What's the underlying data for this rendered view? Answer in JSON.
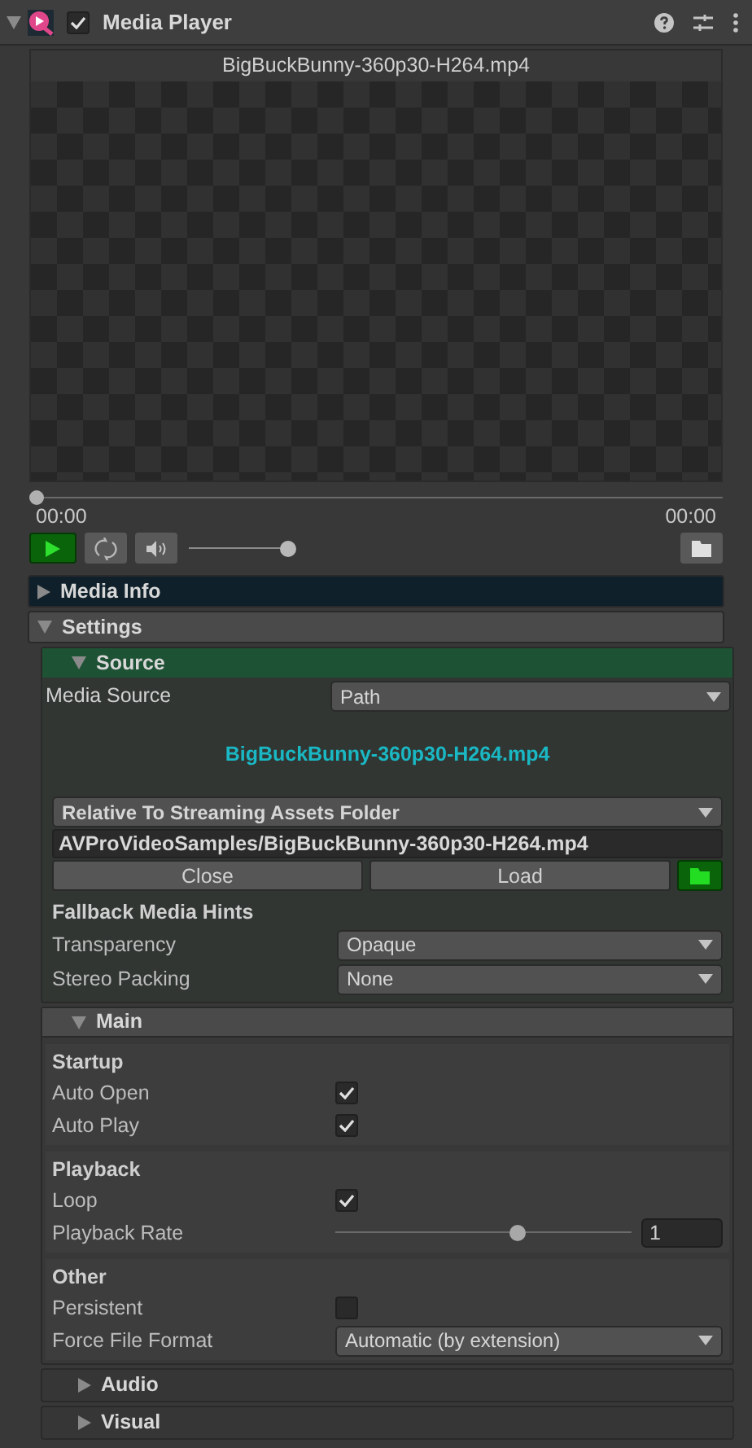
{
  "component": {
    "title": "Media Player",
    "expanded": true,
    "enabled": true
  },
  "preview": {
    "filename": "BigBuckBunny-360p30-H264.mp4",
    "seek": {
      "level": 0
    },
    "current_time": "00:00",
    "duration": "00:00",
    "volume": {
      "level": 1
    }
  },
  "sections": [
    {
      "title": "Media Info",
      "expanded": false,
      "kind": "info"
    },
    {
      "title": "Settings",
      "expanded": true,
      "kind": "settings"
    }
  ],
  "source": {
    "title": "Source",
    "expanded": true,
    "media_source": {
      "label": "Media Source",
      "value": "Path"
    },
    "path_display": "BigBuckBunny-360p30-H264.mp4",
    "relative_to": "Relative To Streaming Assets Folder",
    "path": "AVProVideoSamples/BigBuckBunny-360p30-H264.mp4",
    "buttons": [
      "Close",
      "Load"
    ],
    "hints_title": "Fallback Media Hints",
    "hints": [
      {
        "label": "Transparency",
        "value": "Opaque"
      },
      {
        "label": "Stereo Packing",
        "value": "None"
      }
    ]
  },
  "main": {
    "title": "Main",
    "expanded": true,
    "groups": [
      {
        "title": "Startup",
        "rows": [
          {
            "kind": "checkbox",
            "label": "Auto Open",
            "checked": true
          },
          {
            "kind": "checkbox",
            "label": "Auto Play",
            "checked": true
          }
        ]
      },
      {
        "title": "Playback",
        "rows": [
          {
            "kind": "checkbox",
            "label": "Loop",
            "checked": true
          },
          {
            "kind": "slider",
            "label": "Playback Rate",
            "level": 0.62,
            "value": "1"
          }
        ]
      },
      {
        "title": "Other",
        "rows": [
          {
            "kind": "checkbox",
            "label": "Persistent",
            "checked": false
          },
          {
            "kind": "dropdown",
            "label": "Force File Format",
            "value": "Automatic (by extension)"
          }
        ]
      }
    ]
  },
  "collapsed_sections": [
    {
      "title": "Audio",
      "expanded": false
    },
    {
      "title": "Visual",
      "expanded": false
    }
  ]
}
